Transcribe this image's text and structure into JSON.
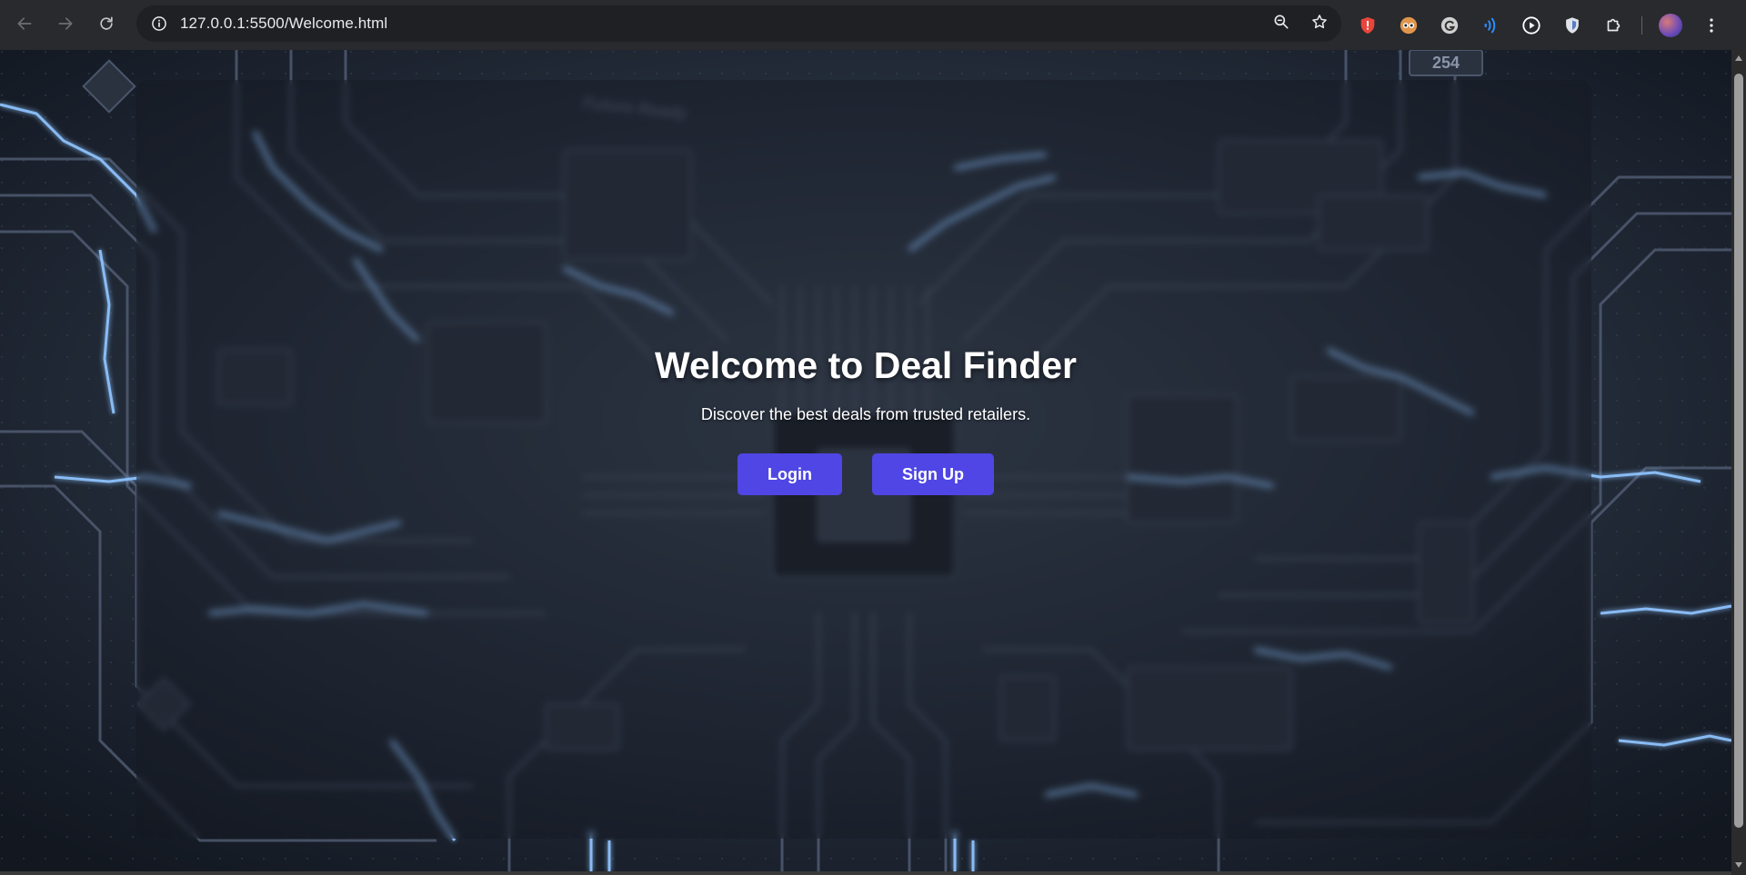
{
  "browser": {
    "url": "127.0.0.1:5500/Welcome.html",
    "icons": {
      "back": "arrow-left-icon",
      "forward": "arrow-right-icon",
      "reload": "reload-icon",
      "site_info": "info-icon",
      "zoom": "zoom-icon",
      "bookmark": "star-icon",
      "menu": "kebab-menu-icon"
    },
    "extensions": [
      "shield-extension",
      "eyes-extension",
      "grammarly-extension",
      "voice-extension",
      "play-extension",
      "privacy-badger-extension",
      "puzzle-icon"
    ]
  },
  "page": {
    "title": "Welcome to Deal Finder",
    "subtitle": "Discover the best deals from trusted retailers.",
    "buttons": {
      "login": "Login",
      "signup": "Sign Up"
    },
    "background_decor": {
      "chip_label": "254",
      "board_text": "Future Ready"
    }
  },
  "colors": {
    "accent": "#4f46e5",
    "chrome_bg": "#282a2d",
    "omnibox_bg": "#1f2023",
    "page_bg": "#141a24",
    "glow": "#8fc4ff"
  }
}
